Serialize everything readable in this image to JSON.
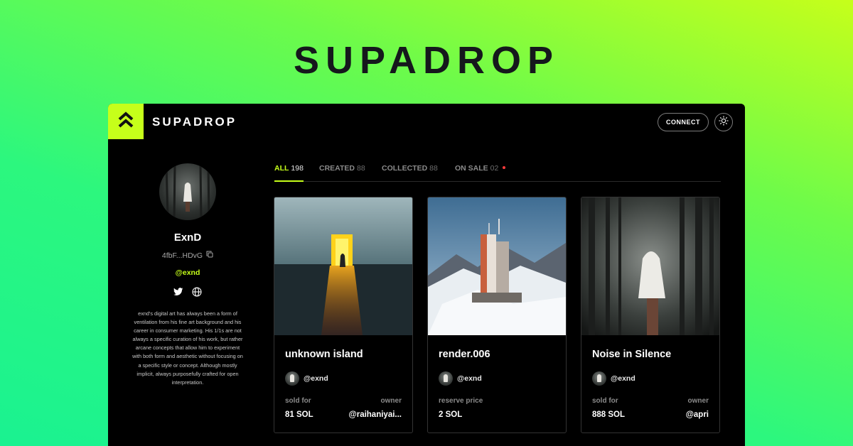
{
  "hero": {
    "title": "SUPADROP"
  },
  "header": {
    "brand": "SUPADROP",
    "connect_label": "CONNECT",
    "logo_icon": "double-chevron-up-icon",
    "theme_icon": "sun-icon",
    "accent_color": "#c6ff1a"
  },
  "profile": {
    "name": "ExnD",
    "wallet": "4fbF...HDvG",
    "handle": "@exnd",
    "socials": [
      "twitter-icon",
      "globe-icon"
    ],
    "bio": "exnd's digital art has always been a form of ventilation from his fine art background and his career in consumer marketing. His 1/1s are not always a specific curation of his work, but rather arcane concepts that allow him to experiment with both form and aesthetic without focusing on a specific style or concept. Although mostly implicit, always purposefully crafted for open interpretation."
  },
  "tabs": [
    {
      "label": "ALL",
      "count": "198"
    },
    {
      "label": "CREATED",
      "count": "88"
    },
    {
      "label": "COLLECTED",
      "count": "88"
    },
    {
      "label": "ON SALE",
      "count": "02"
    }
  ],
  "cards": [
    {
      "title": "unknown island",
      "creator": "@exnd",
      "left_label": "sold for",
      "left_value": "81 SOL",
      "right_label": "owner",
      "right_value": "@raihaniyai..."
    },
    {
      "title": "render.006",
      "creator": "@exnd",
      "left_label": "reserve price",
      "left_value": "2 SOL"
    },
    {
      "title": "Noise in Silence",
      "creator": "@exnd",
      "left_label": "sold for",
      "left_value": "888 SOL",
      "right_label": "owner",
      "right_value": "@apri"
    }
  ]
}
